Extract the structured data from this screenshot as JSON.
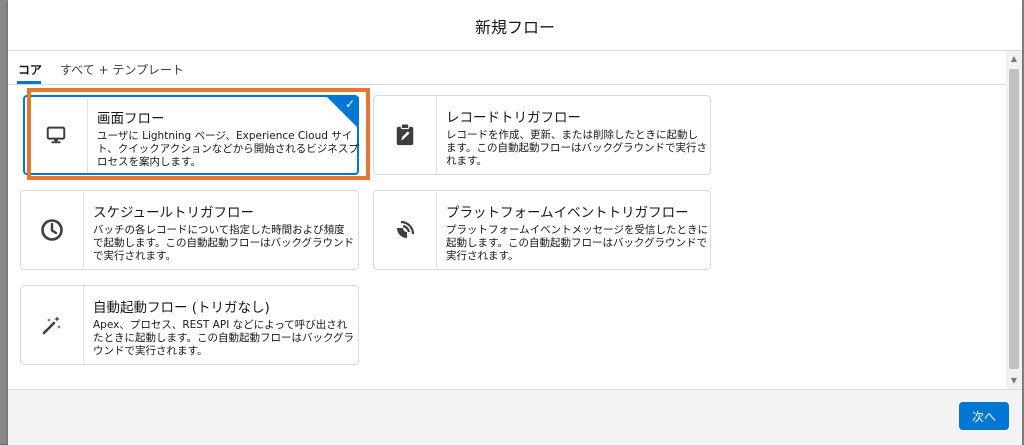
{
  "modal": {
    "title": "新規フロー"
  },
  "tabs": [
    {
      "label": "コア",
      "active": true
    },
    {
      "label": "すべて + テンプレート",
      "active": false
    }
  ],
  "cards": [
    {
      "title": "画面フロー",
      "description": "ユーザに Lightning ページ、Experience Cloud サイト、クイックアクションなどから開始されるビジネスプロセスを案内します。",
      "icon": "monitor-icon",
      "selected": true
    },
    {
      "title": "レコードトリガフロー",
      "description": "レコードを作成、更新、または削除したときに起動します。この自動起動フローはバックグラウンドで実行されます。",
      "icon": "clipboard-edit-icon",
      "selected": false
    },
    {
      "title": "スケジュールトリガフロー",
      "description": "バッチの各レコードについて指定した時間および頻度で起動します。この自動起動フローはバックグラウンドで実行されます。",
      "icon": "clock-icon",
      "selected": false
    },
    {
      "title": "プラットフォームイベントトリガフロー",
      "description": "プラットフォームイベントメッセージを受信したときに起動します。この自動起動フローはバックグラウンドで実行されます。",
      "icon": "broadcast-icon",
      "selected": false
    },
    {
      "title": "自動起動フロー (トリガなし)",
      "description": "Apex、プロセス、REST API などによって呼び出されたときに起動します。この自動起動フローはバックグラウンドで実行されます。",
      "icon": "magic-wand-icon",
      "selected": false
    }
  ],
  "footer": {
    "next_label": "次へ"
  },
  "colors": {
    "brand": "#0176d3",
    "highlight": "#e8772e"
  }
}
